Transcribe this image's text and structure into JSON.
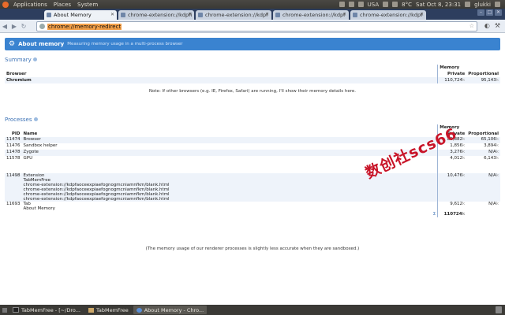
{
  "top_panel": {
    "menus": [
      "Applications",
      "Places",
      "System"
    ],
    "keyboard": "USA",
    "temperature": "8°C",
    "clock": "Sat Oct 8, 23:31",
    "user": "glukki"
  },
  "tabs": [
    {
      "label": "About Memory",
      "active": true
    },
    {
      "label": "chrome-extension://kdpfi",
      "active": false
    },
    {
      "label": "chrome-extension://kdpf",
      "active": false
    },
    {
      "label": "chrome-extension://kdpf",
      "active": false
    },
    {
      "label": "chrome-extension://kdpf",
      "active": false
    }
  ],
  "toolbar": {
    "url": "chrome://memory-redirect"
  },
  "page": {
    "banner": {
      "title": "About memory",
      "subtitle": "Measuring memory usage in a multi-process browser"
    },
    "summary": {
      "title": "Summary",
      "memory_header": "Memory",
      "browser_header": "Browser",
      "private_header": "Private",
      "proportional_header": "Proportional",
      "rows": [
        {
          "name": "Chromium",
          "private": "110,724",
          "private_unit": "k",
          "proportional": "95,143",
          "prop_unit": "k"
        }
      ],
      "note": "Note: If other browsers (e.g. IE, Firefox, Safari) are running, I'll show their memory details here."
    },
    "processes": {
      "title": "Processes",
      "memory_header": "Memory",
      "pid_header": "PID",
      "name_header": "Name",
      "private_header": "Private",
      "proportional_header": "Proportional",
      "rows": [
        {
          "pid": "11474",
          "name": "Browser",
          "details": [],
          "private": "80,882",
          "private_unit": "k",
          "proportional": "65,106",
          "prop_unit": "k",
          "shade": true
        },
        {
          "pid": "11476",
          "name": "Sandbox helper",
          "details": [],
          "private": "1,856",
          "private_unit": "k",
          "proportional": "3,894",
          "prop_unit": "k",
          "shade": false
        },
        {
          "pid": "11478",
          "name": "Zygote",
          "details": [],
          "private": "3,276",
          "private_unit": "k",
          "proportional": "N/A",
          "prop_unit": "k",
          "shade": true
        },
        {
          "pid": "11578",
          "name": "GPU",
          "details": [],
          "private": "4,012",
          "private_unit": "k",
          "proportional": "6,143",
          "prop_unit": "k",
          "shade": false
        },
        {
          "pid": "11498",
          "name": "Extension",
          "details": [
            "TabMemFree",
            "chrome-extension://kdpfaoceexpiaefognogmcniamnfkm/blank.html",
            "chrome-extension://kdpfaoceexpiaefognogmcniamnfkm/blank.html",
            "chrome-extension://kdpfaoceexpiaefognogmcniamnfkm/blank.html",
            "chrome-extension://kdpfaoceexpiaefognogmcniamnfkm/blank.html"
          ],
          "private": "10,476",
          "private_unit": "k",
          "proportional": "N/A",
          "prop_unit": "k",
          "shade": true
        },
        {
          "pid": "11693",
          "name": "Tab",
          "details": [
            "About Memory"
          ],
          "private": "9,612",
          "private_unit": "k",
          "proportional": "N/A",
          "prop_unit": "k",
          "shade": false
        }
      ],
      "sum_label": "Σ",
      "total_private": "110724",
      "total_unit": "k",
      "note": "(The memory usage of our renderer processes is slightly less accurate when they are sandboxed.)"
    }
  },
  "watermark": "数创社scs66",
  "taskbar": [
    {
      "label": "TabMemFree - [~/Dro...",
      "icon": "terminal-icon",
      "active": false
    },
    {
      "label": "TabMemFree",
      "icon": "folder-icon",
      "active": false
    },
    {
      "label": "About Memory - Chro...",
      "icon": "chromium-icon",
      "active": true
    }
  ]
}
